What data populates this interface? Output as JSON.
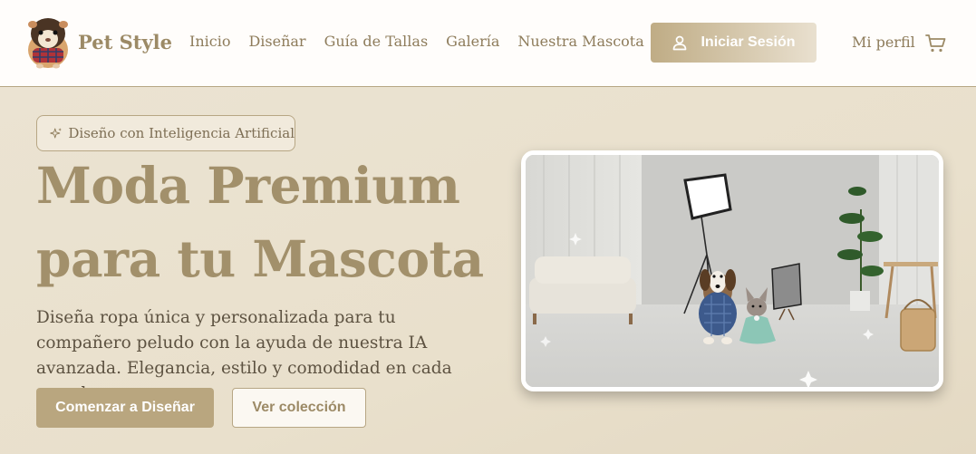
{
  "header": {
    "brand": "Pet Style",
    "logo_icon": "guinea-pig-logo",
    "nav": [
      "Inicio",
      "Diseñar",
      "Guía de Tallas",
      "Galería",
      "Nuestra Mascota"
    ],
    "login_label": "Iniciar Sesión",
    "login_icon": "user-icon",
    "profile_label": "Mi perfil",
    "cart_icon": "cart-icon"
  },
  "hero": {
    "badge": "Diseño con Inteligencia Artificial",
    "badge_icon": "sparkles-icon",
    "title_line1": "Moda Premium",
    "title_line2": "para tu Mascota",
    "description": "Diseña ropa única y personalizada para tu compañero peludo con la ayuda de nuestra IA avanzada. Elegancia, estilo y comodidad en cada prenda.",
    "primary_button": "Comenzar a Diseñar",
    "secondary_button": "Ver colección"
  },
  "colors": {
    "accent": "#b9a67f",
    "brand_text": "#9c8a66",
    "hero_bg": "#ebe3d2"
  }
}
